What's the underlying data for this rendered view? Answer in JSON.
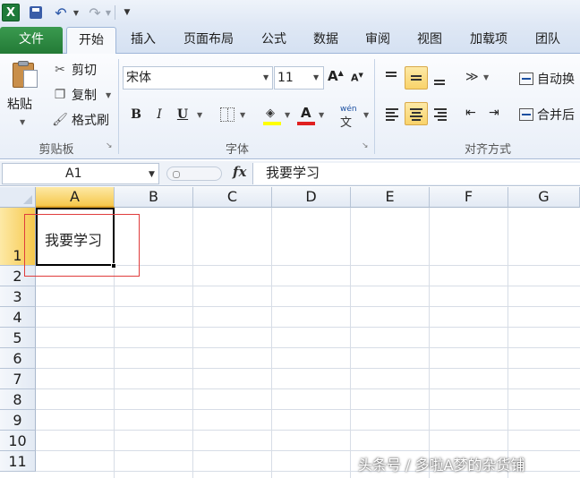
{
  "quick_access": {
    "app_icon_letter": "X",
    "save_icon": "save-icon",
    "undo_icon": "undo-icon",
    "redo_icon": "redo-icon"
  },
  "tabs": [
    {
      "id": "file",
      "label": "文件"
    },
    {
      "id": "home",
      "label": "开始"
    },
    {
      "id": "insert",
      "label": "插入"
    },
    {
      "id": "layout",
      "label": "页面布局"
    },
    {
      "id": "formula",
      "label": "公式"
    },
    {
      "id": "data",
      "label": "数据"
    },
    {
      "id": "review",
      "label": "审阅"
    },
    {
      "id": "view",
      "label": "视图"
    },
    {
      "id": "addins",
      "label": "加载项"
    },
    {
      "id": "team",
      "label": "团队"
    }
  ],
  "ribbon": {
    "clipboard": {
      "paste": "粘贴",
      "cut": "剪切",
      "copy": "复制",
      "format_painter": "格式刷",
      "group_label": "剪贴板"
    },
    "font": {
      "font_name": "宋体",
      "font_size": "11",
      "bold": "B",
      "italic": "I",
      "underline": "U",
      "grow": "A",
      "shrink": "A",
      "font_color_letter": "A",
      "phonetic": "wén",
      "group_label": "字体",
      "fill_color": "#ffff00",
      "font_color": "#e02020"
    },
    "alignment": {
      "wrap_text": "自动换",
      "merge_center": "合并后",
      "group_label": "对齐方式"
    }
  },
  "formula_bar": {
    "name_box": "A1",
    "fx": "fx",
    "content": "我要学习"
  },
  "sheet": {
    "columns": [
      "A",
      "B",
      "C",
      "D",
      "E",
      "F",
      "G"
    ],
    "rows": [
      "1",
      "2",
      "3",
      "4",
      "5",
      "6",
      "7",
      "8",
      "9",
      "10",
      "11"
    ],
    "selected_cell": "A1",
    "cells": {
      "A1": "我要学习"
    }
  },
  "watermark": "头条号 / 多啦A梦的杂货铺",
  "colors": {
    "file_tab": "#237a36",
    "selection_highlight": "#f6c84c",
    "annotation": "#e03c3c"
  }
}
